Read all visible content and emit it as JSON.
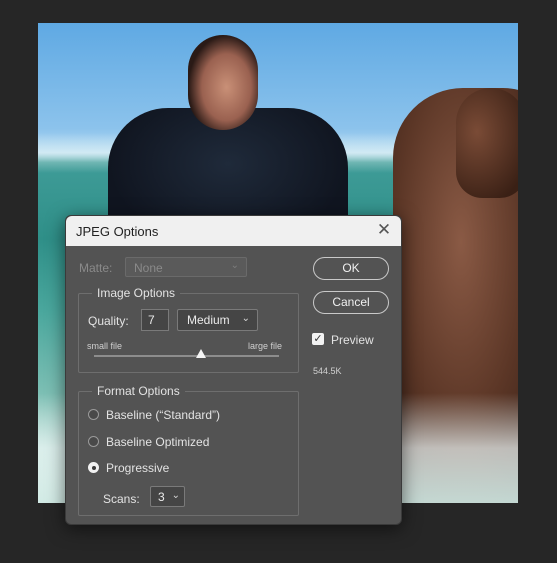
{
  "dialog": {
    "title": "JPEG Options",
    "close_glyph": "✕",
    "matte": {
      "label": "Matte:",
      "value": "None",
      "enabled": false
    },
    "image_options": {
      "legend": "Image Options",
      "quality_label": "Quality:",
      "quality_value": "7",
      "quality_preset": "Medium",
      "slider_min_label": "small file",
      "slider_max_label": "large file",
      "slider_position": 0.58
    },
    "format_options": {
      "legend": "Format Options",
      "radios": [
        {
          "label": "Baseline (“Standard”)",
          "selected": false
        },
        {
          "label": "Baseline Optimized",
          "selected": false
        },
        {
          "label": "Progressive",
          "selected": true
        }
      ],
      "scans_label": "Scans:",
      "scans_value": "3"
    },
    "buttons": {
      "ok": "OK",
      "cancel": "Cancel"
    },
    "preview": {
      "label": "Preview",
      "checked": true,
      "check_glyph": "✓"
    },
    "file_size": "544.5K"
  },
  "icons": {
    "chevron": "⌄"
  },
  "colors": {
    "dialog_bg": "#535353",
    "titlebar_bg": "#f0f0f0",
    "app_bg": "#262626"
  }
}
